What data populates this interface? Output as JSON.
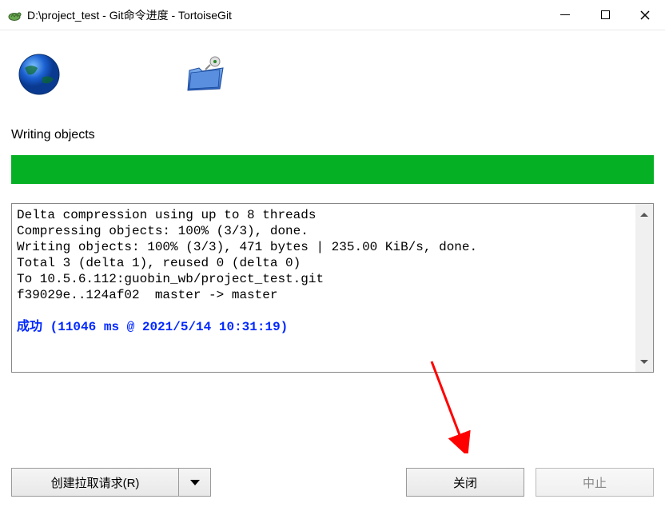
{
  "titlebar": {
    "title": "D:\\project_test - Git命令进度 - TortoiseGit"
  },
  "status": {
    "label": "Writing objects"
  },
  "progress": {
    "percent": 100,
    "color": "#06B025"
  },
  "output": {
    "lines": [
      "Delta compression using up to 8 threads",
      "Compressing objects: 100% (3/3), done.",
      "Writing objects: 100% (3/3), 471 bytes | 235.00 KiB/s, done.",
      "Total 3 (delta 1), reused 0 (delta 0)",
      "To 10.5.6.112:guobin_wb/project_test.git",
      "f39029e..124af02  master -> master"
    ],
    "success_label": "成功",
    "success_detail": "(11046 ms @ 2021/5/14 10:31:19)"
  },
  "buttons": {
    "pull_request": "创建拉取请求(R)",
    "close": "关闭",
    "abort": "中止"
  }
}
